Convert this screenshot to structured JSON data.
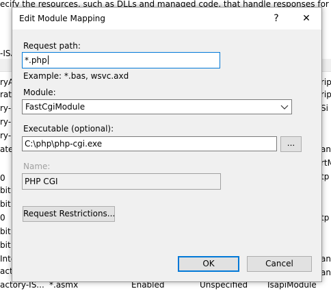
{
  "background": {
    "top_text": "ecify the resources, such as DLLs and managed code, that handle responses for specific requ",
    "left_column": [
      "-ISA",
      "ryAp",
      "rate",
      "ry-I",
      "ry-I",
      "ry-I",
      "ated",
      "0",
      "bit",
      "bit",
      "0",
      "bit",
      "bit",
      "Inte",
      "actory",
      "actory-IS..."
    ],
    "right_column": [
      "rip",
      "rip",
      "Si",
      "",
      "",
      "anc",
      "rtM",
      "tp",
      "",
      "",
      "tp",
      "",
      "",
      "anc",
      "anc"
    ],
    "bottom_row": {
      "name": "actory-IS...",
      "path": "*.asmx",
      "state": "Enabled",
      "type": "Unspecified",
      "handler": "IsapiModule"
    }
  },
  "dialog": {
    "title": "Edit Module Mapping",
    "help_glyph": "?",
    "close_glyph": "✕",
    "request_path_label": "Request path:",
    "request_path_value": "*.php",
    "example_text": "Example: *.bas, wsvc.axd",
    "module_label": "Module:",
    "module_value": "FastCgiModule",
    "executable_label": "Executable (optional):",
    "executable_value": "C:\\php\\php-cgi.exe",
    "browse_label": "...",
    "name_label": "Name:",
    "name_value": "PHP CGI",
    "request_restrictions_label": "Request Restrictions...",
    "ok_label": "OK",
    "cancel_label": "Cancel"
  },
  "colors": {
    "dialog_bg": "#f0f0f0",
    "focus_border": "#0078d7",
    "disabled_text": "#a0a0a0"
  }
}
